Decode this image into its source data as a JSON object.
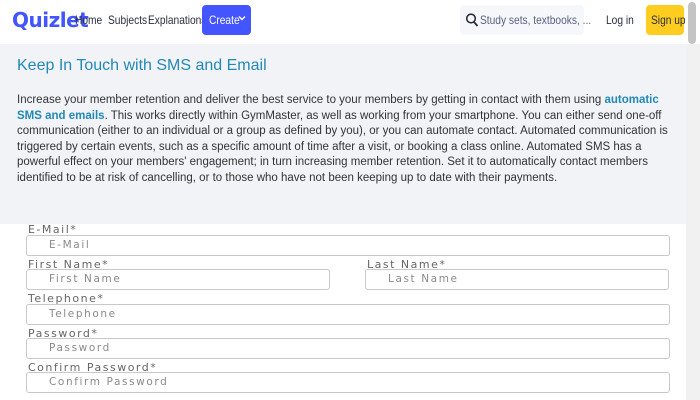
{
  "header": {
    "logo": "Quizlet",
    "links": [
      "Home",
      "Subjects",
      "Explanations"
    ],
    "create_label": "Create",
    "search_placeholder": "Study sets, textbooks, ...",
    "login_label": "Log in",
    "signup_label": "Sign up"
  },
  "info": {
    "title": "Keep In Touch with SMS and Email",
    "para_before": "Increase your member retention and deliver the best service to your members by getting in contact with them using ",
    "para_highlight": "automatic SMS and emails",
    "para_after": ". This works directly within GymMaster, as well as working from your smartphone. You can either send one-off communication (either to an individual or a group as defined by you), or you can automate contact. Automated communication is triggered by certain events, such as a specific amount of time after a visit, or booking a class online. Automated SMS has a powerful effect on your members' engagement; in turn increasing member retention. Set it to automatically contact members identified to be at risk of cancelling, or to those who have not been keeping up to date with their payments."
  },
  "form": {
    "email": {
      "label": "E-Mail*",
      "placeholder": "E-Mail"
    },
    "first_name": {
      "label": "First Name*",
      "placeholder": "First Name"
    },
    "last_name": {
      "label": "Last Name*",
      "placeholder": "Last Name"
    },
    "telephone": {
      "label": "Telephone*",
      "placeholder": "Telephone"
    },
    "password": {
      "label": "Password*",
      "placeholder": "Password"
    },
    "confirm_password": {
      "label": "Confirm Password*",
      "placeholder": "Confirm Password"
    }
  },
  "colors": {
    "brand": "#4255ff",
    "signup": "#ffcd1f",
    "heading": "#2189b7"
  },
  "icons": [
    "search-icon",
    "chevron-down-icon"
  ]
}
